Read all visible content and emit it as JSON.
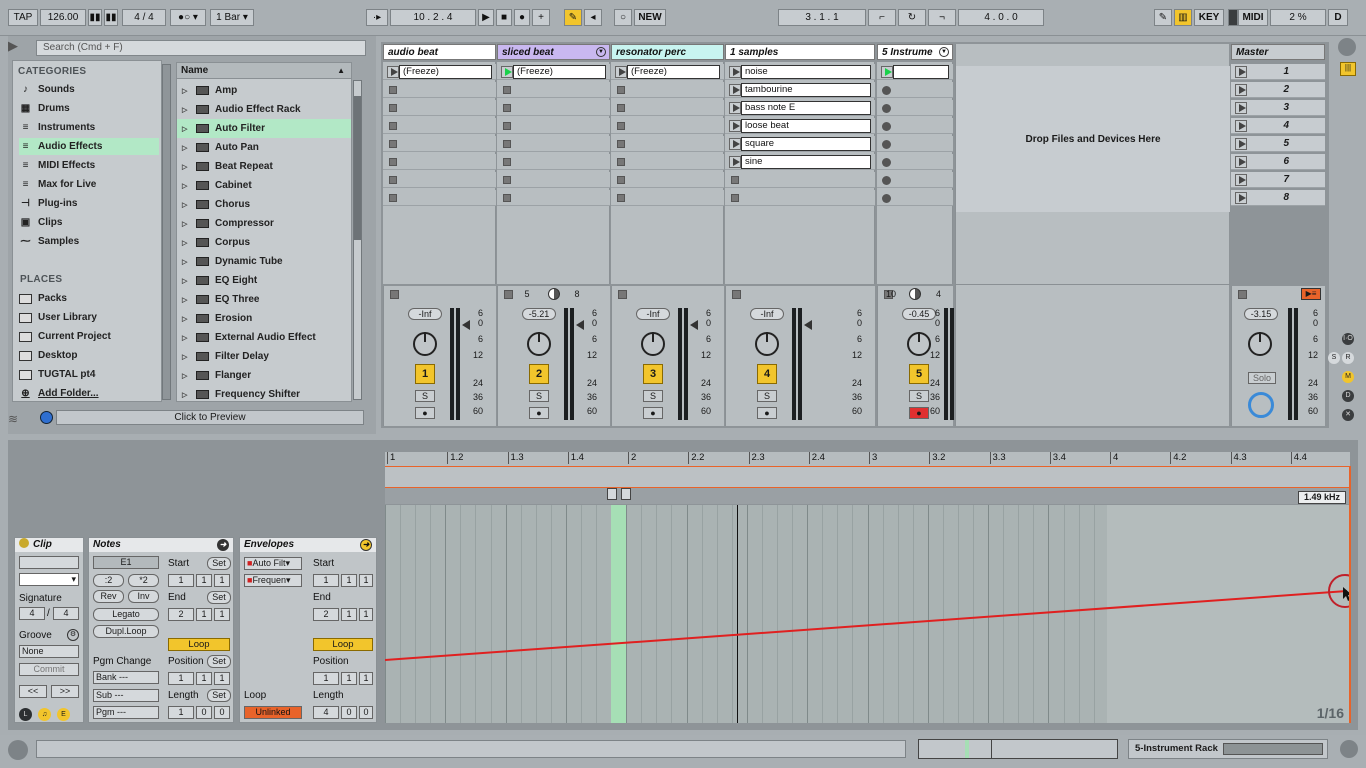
{
  "transport": {
    "tap": "TAP",
    "tempo": "126.00",
    "signature": "4 / 4",
    "quantize": "1 Bar",
    "position": "10 .   2 .   4",
    "new_label": "NEW",
    "loop_start": "3 .   1 .   1",
    "loop_length": "4 .   0 .   0",
    "key_label": "KEY",
    "midi_label": "MIDI",
    "cpu": "2 %",
    "d_label": "D"
  },
  "browser": {
    "search_placeholder": "Search (Cmd + F)",
    "categories_title": "CATEGORIES",
    "categories": [
      {
        "label": "Sounds",
        "icon": "note-icon"
      },
      {
        "label": "Drums",
        "icon": "grid-icon"
      },
      {
        "label": "Instruments",
        "icon": "sliders-icon"
      },
      {
        "label": "Audio Effects",
        "icon": "sliders-icon"
      },
      {
        "label": "MIDI Effects",
        "icon": "sliders-icon"
      },
      {
        "label": "Max for Live",
        "icon": "sliders-icon"
      },
      {
        "label": "Plug-ins",
        "icon": "plug-icon"
      },
      {
        "label": "Clips",
        "icon": "clip-icon"
      },
      {
        "label": "Samples",
        "icon": "wave-icon"
      }
    ],
    "places_title": "PLACES",
    "places": [
      "Packs",
      "User Library",
      "Current Project",
      "Desktop",
      "TUGTAL pt4"
    ],
    "add_folder": "Add Folder...",
    "name_header": "Name",
    "items": [
      "Amp",
      "Audio Effect Rack",
      "Auto Filter",
      "Auto Pan",
      "Beat Repeat",
      "Cabinet",
      "Chorus",
      "Compressor",
      "Corpus",
      "Dynamic Tube",
      "EQ Eight",
      "EQ Three",
      "Erosion",
      "External Audio Effect",
      "Filter Delay",
      "Flanger",
      "Frequency Shifter"
    ],
    "preview": "Click to Preview"
  },
  "session": {
    "tracks": [
      {
        "name": "audio beat",
        "color": "#ffffff",
        "clips": [
          "(Freeze)"
        ],
        "volume": "-Inf",
        "number": "1"
      },
      {
        "name": "sliced beat",
        "color": "#c9b8f0",
        "clips": [
          "(Freeze)"
        ],
        "volume": "-5.21",
        "number": "2",
        "sends_a": "5",
        "sends_b": "8"
      },
      {
        "name": "resonator perc",
        "color": "#c8f4f0",
        "clips": [
          "(Freeze)"
        ],
        "volume": "-Inf",
        "number": "3"
      },
      {
        "name": "1 samples",
        "color": "#ffffff",
        "clips": [
          "noise",
          "tambourine",
          "bass note E",
          "loose beat",
          "square",
          "sine"
        ],
        "volume": "-Inf",
        "number": "4"
      },
      {
        "name": "5 Instrume",
        "color": "#ffffff",
        "clips": [
          ""
        ],
        "volume": "-0.45",
        "number": "5",
        "sends_a": "10",
        "sends_b": "4"
      }
    ],
    "drop_text": "Drop Files and Devices Here",
    "master": {
      "name": "Master",
      "scenes": [
        "1",
        "2",
        "3",
        "4",
        "5",
        "6",
        "7",
        "8"
      ],
      "volume": "-3.15",
      "solo": "Solo"
    },
    "meter_scale": [
      "6",
      "0",
      "6",
      "12",
      "24",
      "36",
      "60"
    ],
    "solo_label": "S"
  },
  "ruler": {
    "ticks": [
      "1",
      "1.2",
      "1.3",
      "1.4",
      "2",
      "2.2",
      "2.3",
      "2.4",
      "3",
      "3.2",
      "3.3",
      "3.4",
      "4",
      "4.2",
      "4.3",
      "4.4"
    ],
    "freq_readout": "1.49 kHz",
    "grid": "1/16"
  },
  "clip_panel": {
    "title": "Clip",
    "signature_label": "Signature",
    "sig_num": "4",
    "sig_den": "4",
    "groove_label": "Groove",
    "groove_value": "None",
    "commit": "Commit",
    "nav_prev": "<<",
    "nav_next": ">>"
  },
  "notes_panel": {
    "title": "Notes",
    "key": "E1",
    "div2": ":2",
    "mul2": "*2",
    "rev": "Rev",
    "inv": "Inv",
    "legato": "Legato",
    "dupl": "Dupl.Loop",
    "pgm_change": "Pgm Change",
    "bank": "Bank ---",
    "sub": "Sub ---",
    "pgm": "Pgm ---",
    "start": "Start",
    "end": "End",
    "set": "Set",
    "loop": "Loop",
    "position": "Position",
    "length": "Length",
    "start_vals": [
      "1",
      "1",
      "1"
    ],
    "end_vals": [
      "2",
      "1",
      "1"
    ],
    "pos_vals": [
      "1",
      "1",
      "1"
    ],
    "len_vals": [
      "1",
      "0",
      "0"
    ]
  },
  "env_panel": {
    "title": "Envelopes",
    "device": "Auto Filt",
    "param": "Frequen",
    "start": "Start",
    "end": "End",
    "loop": "Loop",
    "position": "Position",
    "length": "Length",
    "loop_label": "Loop",
    "unlinked": "Unlinked",
    "start_vals": [
      "1",
      "1",
      "1"
    ],
    "end_vals": [
      "2",
      "1",
      "1"
    ],
    "pos_vals": [
      "1",
      "1",
      "1"
    ],
    "len_vals": [
      "4",
      "0",
      "0"
    ]
  },
  "status": {
    "rack_label": "5-Instrument Rack"
  },
  "colors": {
    "accent_green": "#b2e8c6",
    "track_yellow": "#f2c52c",
    "envelope_red": "#e02020"
  }
}
